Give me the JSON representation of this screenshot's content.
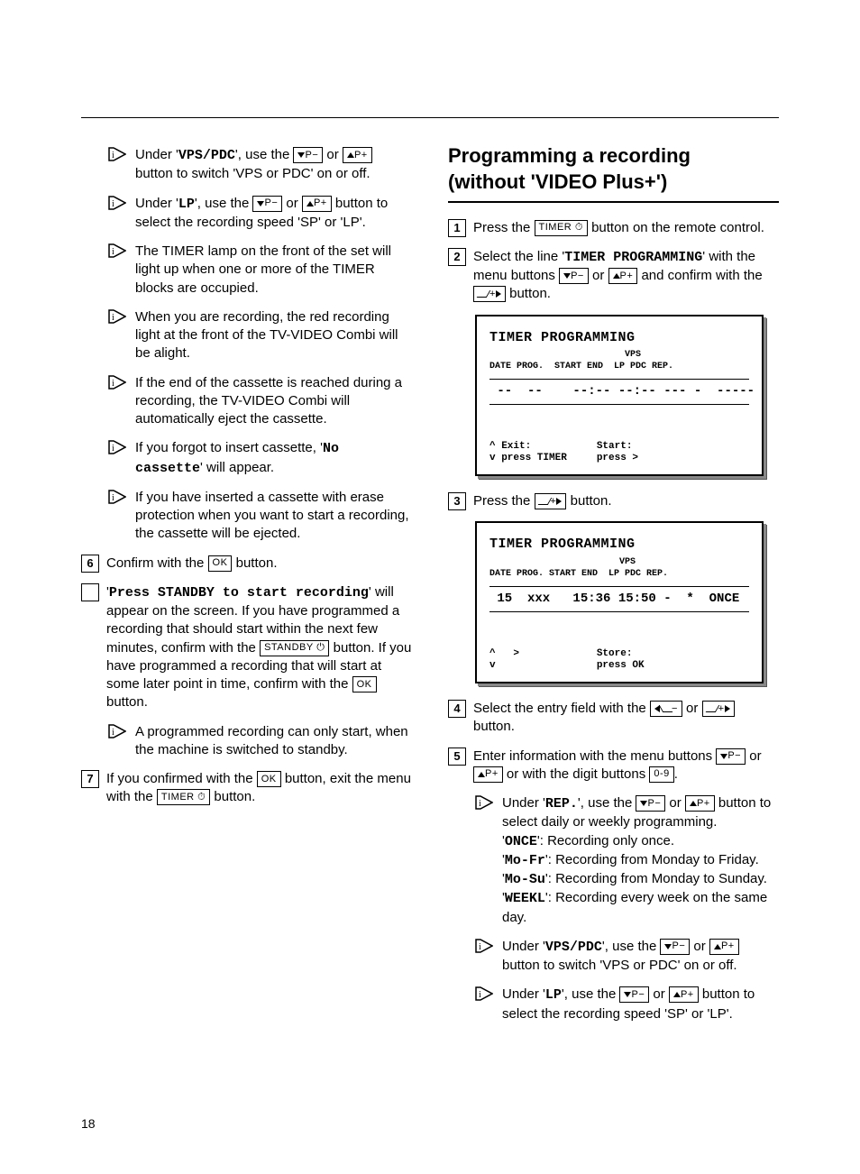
{
  "page_number": "18",
  "left": {
    "tips": [
      {
        "pre": "Under '",
        "code": "VPS/PDC",
        "post_1": "', use the ",
        "post_2": " or ",
        "post_3": " button to switch 'VPS or PDC' on or off."
      },
      {
        "pre": "Under '",
        "code": "LP",
        "post_1": "', use the ",
        "post_2": " or ",
        "post_3": " button to select the recording speed 'SP' or 'LP'."
      },
      {
        "text": "The TIMER lamp on the front of the set will light up when one or more of the TIMER blocks are occupied."
      },
      {
        "text": "When you are recording, the red recording light at the front of the TV-VIDEO Combi will be alight."
      },
      {
        "text": "If the end of the cassette is reached during a recording, the TV-VIDEO Combi will automatically eject the cassette."
      },
      {
        "pre": "If you forgot to insert cassette, '",
        "code": "No cassette",
        "post": "' will appear."
      },
      {
        "text": "If you have inserted a cassette with erase protection when you want to start a recording, the cassette will be ejected."
      }
    ],
    "step6": {
      "num": "6",
      "pre": "Confirm with the ",
      "btn": "OK",
      "post": " button."
    },
    "square_step": {
      "code": "Press STANDBY to start recording",
      "pre2": "' will appear on the screen. If you have programmed a recording that should start within the next few minutes, confirm with the ",
      "btn1": "STANDBY",
      "mid": " button. If you have programmed a recording that will start at some later point in time, confirm with the ",
      "btn2": "OK",
      "post": " button."
    },
    "sub_tip": "A programmed recording can only start, when the machine is switched to standby.",
    "step7": {
      "num": "7",
      "pre": "If you confirmed with the ",
      "btn1": "OK",
      "mid": " button, exit the menu with the ",
      "btn2": "TIMER",
      "post": " button."
    }
  },
  "right": {
    "title_l1": "Programming a recording",
    "title_l2": "(without 'VIDEO Plus+')",
    "step1": {
      "num": "1",
      "pre": "Press the ",
      "btn": "TIMER",
      "post": " button on the remote control."
    },
    "step2": {
      "num": "2",
      "pre": "Select the line '",
      "code": "TIMER PROGRAMMING",
      "mid1": "' with the menu buttons ",
      "mid2": " or ",
      "mid3": " and confirm with the ",
      "post": " button."
    },
    "osd1": {
      "title": "TIMER PROGRAMMING",
      "hdr_r": "                         VPS",
      "hdr": "DATE PROG.  START END  LP PDC REP.",
      "row": " --  --    --:-- --:-- --- -  -----",
      "foot1": "^ Exit:           Start:",
      "foot2": "v press TIMER     press >"
    },
    "step3": {
      "num": "3",
      "pre": "Press the ",
      "post": " button."
    },
    "osd2": {
      "title": "TIMER PROGRAMMING",
      "hdr_r": "                        VPS",
      "hdr": "DATE PROG. START END  LP PDC REP.",
      "row": " 15  xxx   15:36 15:50 -  *  ONCE",
      "foot1": "^   >             Store:",
      "foot2": "v                 press OK"
    },
    "step4": {
      "num": "4",
      "pre": "Select the entry field with the ",
      "mid": " or ",
      "post": " button."
    },
    "step5": {
      "num": "5",
      "pre": "Enter information with the menu buttons ",
      "mid1": " or ",
      "mid2": " or with the digit buttons ",
      "btn": "0-9",
      "post": "."
    },
    "sub": [
      {
        "pre": "Under '",
        "code": "REP.",
        "post1": "', use the ",
        "post2": " or ",
        "post3": " button to select daily or weekly programming.",
        "lines": [
          {
            "code": "ONCE",
            "text": "': Recording only once."
          },
          {
            "code": "Mo-Fr",
            "text": "': Recording from Monday to Friday."
          },
          {
            "code": "Mo-Su",
            "text": "': Recording from Monday to Sunday."
          },
          {
            "code": "WEEKL",
            "text": "': Recording every week on the same day."
          }
        ]
      },
      {
        "pre": "Under '",
        "code": "VPS/PDC",
        "post1": "', use the ",
        "post2": " or ",
        "post3": " button to switch 'VPS or PDC' on or off."
      },
      {
        "pre": "Under '",
        "code": "LP",
        "post1": "', use the ",
        "post2": " or ",
        "post3": " button to select the recording speed 'SP' or 'LP'."
      }
    ]
  }
}
